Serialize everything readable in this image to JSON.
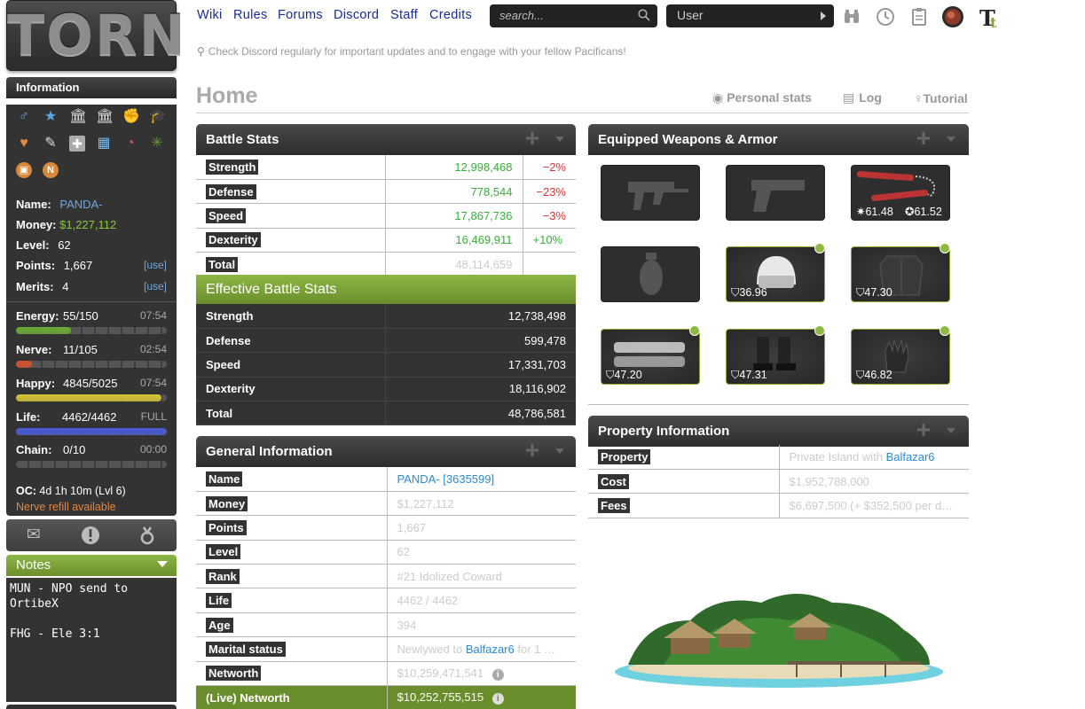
{
  "sidebar": {
    "logo": "TORN",
    "info_title": "Information",
    "name_label": "Name:",
    "name_value": "PANDA-",
    "money_label": "Money:",
    "money_value": "$1,227,112",
    "level_label": "Level:",
    "level_value": "62",
    "points_label": "Points:",
    "points_value": "1,667",
    "points_use": "[use]",
    "merits_label": "Merits:",
    "merits_value": "4",
    "merits_use": "[use]",
    "bars": [
      {
        "label": "Energy:",
        "value": "55/150",
        "time": "07:54",
        "fill": 0.367,
        "color": "#6aab34"
      },
      {
        "label": "Nerve:",
        "value": "11/105",
        "time": "02:54",
        "fill": 0.105,
        "color": "#d4532c"
      },
      {
        "label": "Happy:",
        "value": "4845/5025",
        "time": "07:54",
        "fill": 0.964,
        "color": "#d6c534"
      },
      {
        "label": "Life:",
        "value": "4462/4462",
        "time": "FULL",
        "fill": 1.0,
        "color": "#4a5ad6"
      },
      {
        "label": "Chain:",
        "value": "0/10",
        "time": "00:00",
        "fill": 0.0,
        "color": "#888"
      }
    ],
    "oc_label": "OC:",
    "oc_value": "4d 1h 10m (Lvl 6)",
    "nerve_refill": "Nerve refill available",
    "notes_title": "Notes",
    "notes_text": "MUN - NPO send to\nOrtibeX\n\nFHG - Ele 3:1"
  },
  "topnav": {
    "links": [
      "Wiki",
      "Rules",
      "Forums",
      "Discord",
      "Staff",
      "Credits"
    ],
    "search_placeholder": "search...",
    "user_select": "User",
    "ticker": "Check Discord regularly for important updates and to engage with your fellow Pacificans!"
  },
  "page": {
    "title": "Home",
    "personal_stats": "Personal stats",
    "log": "Log",
    "tutorial": "Tutorial"
  },
  "battle_stats": {
    "title": "Battle Stats",
    "rows": [
      {
        "name": "Strength",
        "value": "12,998,468",
        "mod": "−2%"
      },
      {
        "name": "Defense",
        "value": "778,544",
        "mod": "−23%"
      },
      {
        "name": "Speed",
        "value": "17,867,736",
        "mod": "−3%"
      },
      {
        "name": "Dexterity",
        "value": "16,469,911",
        "mod": "+10%"
      },
      {
        "name": "Total",
        "value": "48,114,659",
        "mod": ""
      }
    ]
  },
  "effective_stats": {
    "title": "Effective Battle Stats",
    "rows": [
      {
        "name": "Strength",
        "value": "12,738,498"
      },
      {
        "name": "Defense",
        "value": "599,478"
      },
      {
        "name": "Speed",
        "value": "17,331,703"
      },
      {
        "name": "Dexterity",
        "value": "18,116,902"
      },
      {
        "name": "Total",
        "value": "48,786,581"
      }
    ]
  },
  "general_info": {
    "title": "General Information",
    "rows": [
      {
        "name": "Name",
        "value": "PANDA- [3635599]"
      },
      {
        "name": "Money",
        "value": "$1,227,112"
      },
      {
        "name": "Points",
        "value": "1,667"
      },
      {
        "name": "Level",
        "value": "62"
      },
      {
        "name": "Rank",
        "value": "#21 Idolized Coward"
      },
      {
        "name": "Life",
        "value": "4462 / 4462"
      },
      {
        "name": "Age",
        "value": "394"
      },
      {
        "name": "Marital status",
        "value_prefix": "Newlywed to ",
        "value_link": "Balfazar6",
        "value_suffix": " for 1 …"
      },
      {
        "name": "Networth",
        "value": "$10,259,471,541"
      },
      {
        "name": "(Live) Networth",
        "value": "$10,252,755,515"
      }
    ]
  },
  "equipment": {
    "title": "Equipped Weapons & Armor",
    "slots": [
      {
        "kind": "smg",
        "stats": []
      },
      {
        "kind": "pistol",
        "stats": []
      },
      {
        "kind": "nunchaku",
        "stats": [
          "61.48",
          "61.52"
        ]
      },
      {
        "kind": "grenade",
        "stats": []
      },
      {
        "kind": "helmet",
        "stats": [
          "36.96"
        ]
      },
      {
        "kind": "body-armor",
        "stats": [
          "47.30"
        ]
      },
      {
        "kind": "pants",
        "stats": [
          "47.20"
        ]
      },
      {
        "kind": "boots",
        "stats": [
          "47.31"
        ]
      },
      {
        "kind": "gloves",
        "stats": [
          "46.82"
        ]
      }
    ]
  },
  "property": {
    "title": "Property Information",
    "rows": [
      {
        "name": "Property",
        "value_prefix": "Private Island with ",
        "value_link": "Balfazar6"
      },
      {
        "name": "Cost",
        "value": "$1,952,788,000"
      },
      {
        "name": "Fees",
        "value": "$6,697,500 (+ $352,500 per d…"
      }
    ]
  },
  "colors": {
    "accent_green": "#7ea23a",
    "dark_panel": "#333333",
    "link_blue": "#2b8bd8"
  }
}
